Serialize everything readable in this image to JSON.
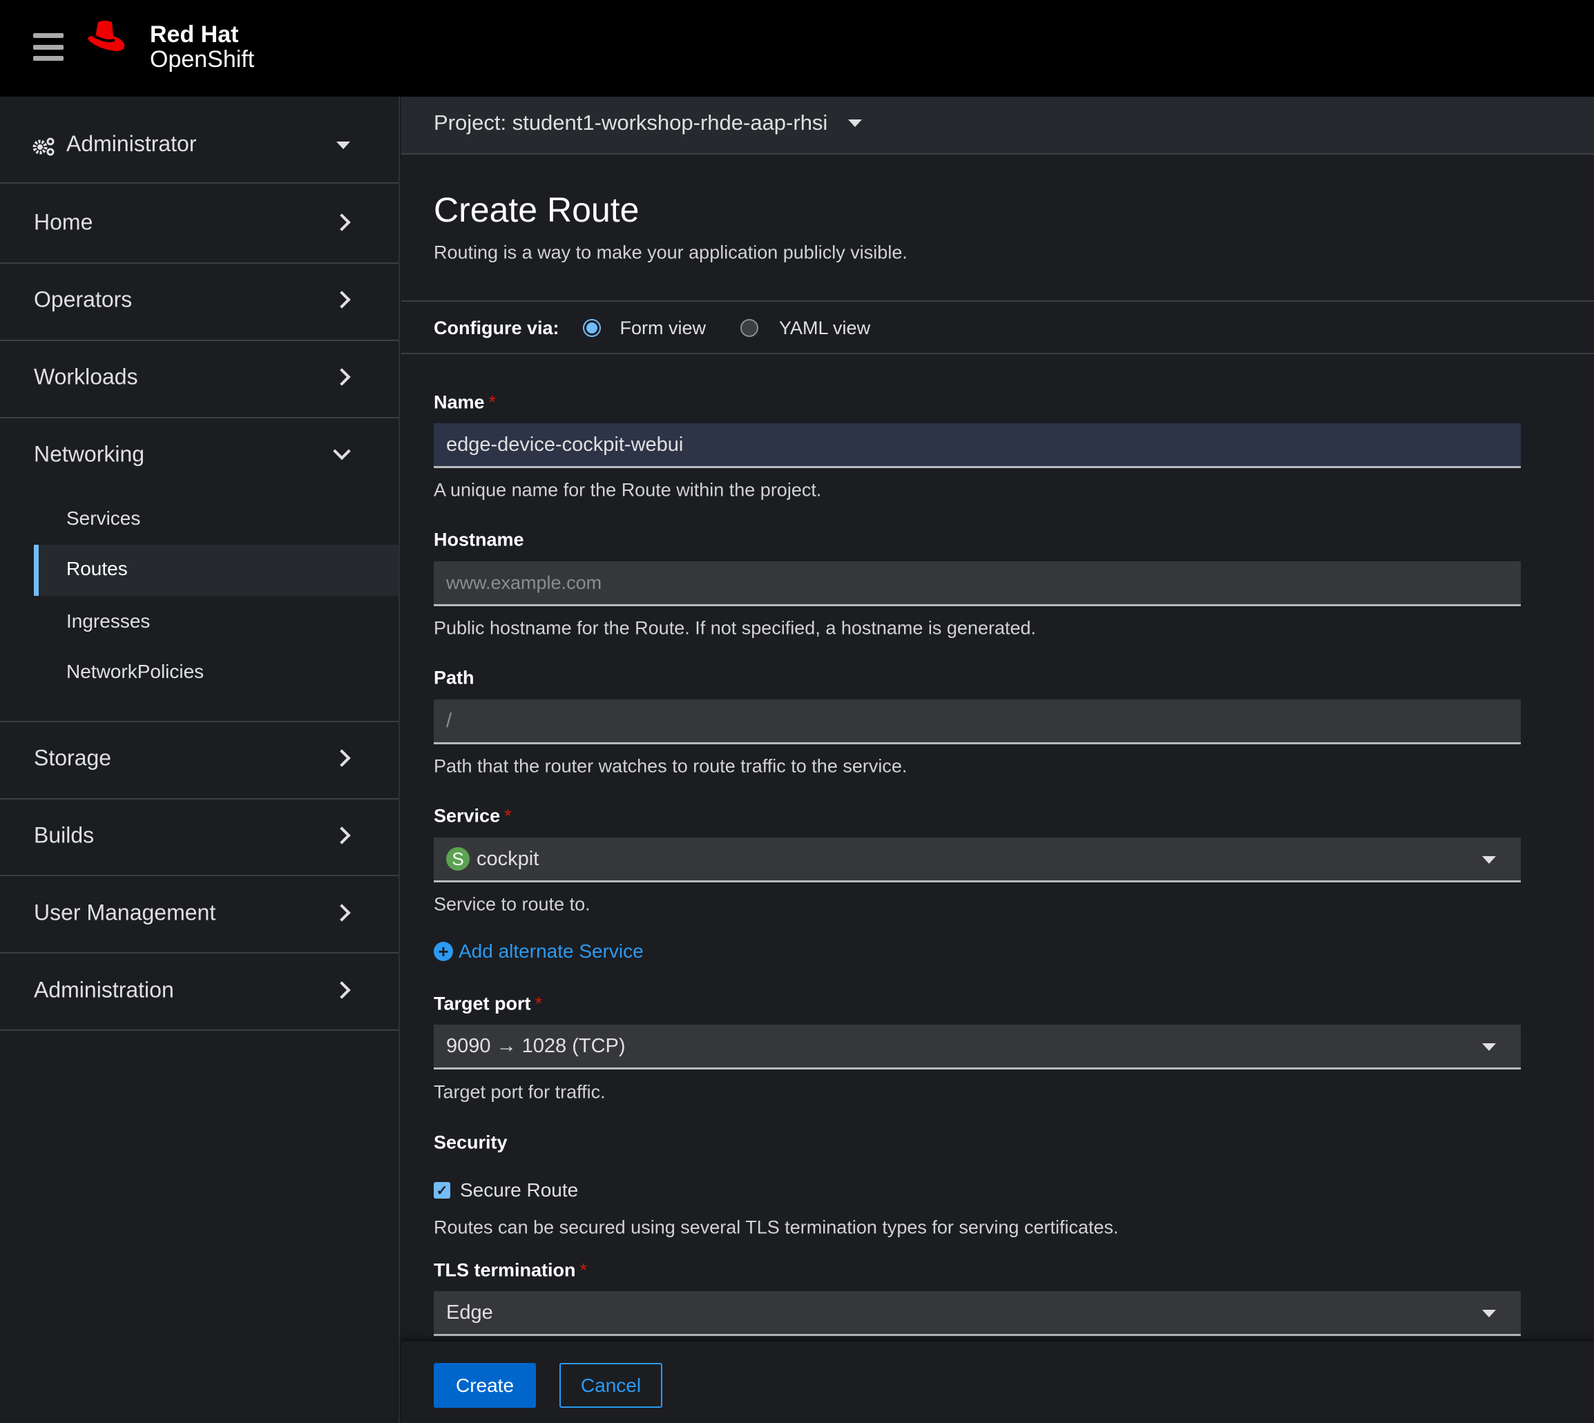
{
  "masthead": {
    "brand_line1": "Red Hat",
    "brand_line2": "OpenShift"
  },
  "project": {
    "label": "Project: student1-workshop-rhde-aap-rhsi"
  },
  "sidebar": {
    "perspective": "Administrator",
    "items": [
      {
        "label": "Home"
      },
      {
        "label": "Operators"
      },
      {
        "label": "Workloads"
      },
      {
        "label": "Networking",
        "expanded": true,
        "children": [
          {
            "label": "Services"
          },
          {
            "label": "Routes",
            "active": true
          },
          {
            "label": "Ingresses"
          },
          {
            "label": "NetworkPolicies"
          }
        ]
      },
      {
        "label": "Storage"
      },
      {
        "label": "Builds"
      },
      {
        "label": "User Management"
      },
      {
        "label": "Administration"
      }
    ]
  },
  "page": {
    "title": "Create Route",
    "subtitle": "Routing is a way to make your application publicly visible.",
    "configure_label": "Configure via:",
    "form_view": "Form view",
    "yaml_view": "YAML view",
    "selected_view": "Form view"
  },
  "form": {
    "name": {
      "label": "Name",
      "value": "edge-device-cockpit-webui",
      "help": "A unique name for the Route within the project."
    },
    "hostname": {
      "label": "Hostname",
      "placeholder": "www.example.com",
      "help": "Public hostname for the Route. If not specified, a hostname is generated."
    },
    "path": {
      "label": "Path",
      "placeholder": "/",
      "help": "Path that the router watches to route traffic to the service."
    },
    "service": {
      "label": "Service",
      "badge": "S",
      "value": "cockpit",
      "help": "Service to route to."
    },
    "add_alternate": "Add alternate Service",
    "target_port": {
      "label": "Target port",
      "value": "9090 → 1028 (TCP)",
      "help": "Target port for traffic."
    },
    "security": {
      "label": "Security",
      "secure_route": "Secure Route",
      "secure_checked": true,
      "help": "Routes can be secured using several TLS termination types for serving certificates."
    },
    "tls": {
      "label": "TLS termination",
      "value": "Edge"
    },
    "required_mark": "*"
  },
  "footer": {
    "create": "Create",
    "cancel": "Cancel"
  },
  "colors": {
    "accent": "#73bcf7",
    "primary": "#0066cc",
    "link": "#2b9af3",
    "required": "#c9190b",
    "brand_red": "#ee0000",
    "service_badge": "#5ba352"
  }
}
